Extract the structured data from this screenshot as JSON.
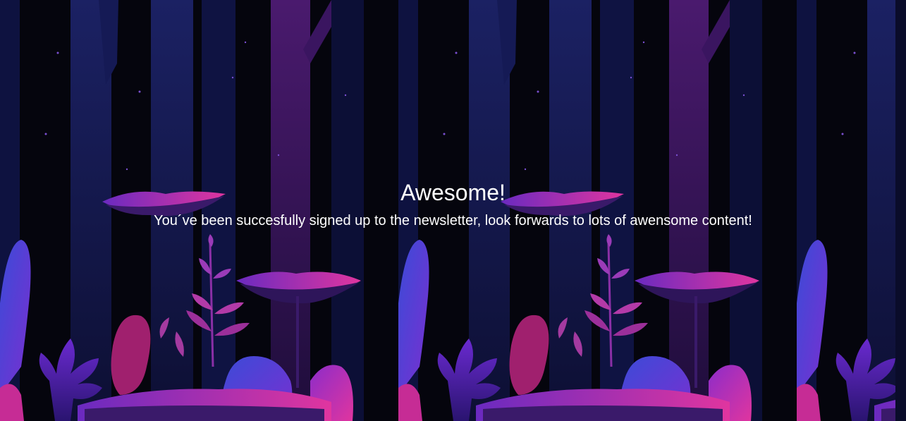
{
  "confirmation": {
    "title": "Awesome!",
    "message": "You´ve been succesfully signed up to the newsletter, look forwards to lots of awensome content!"
  },
  "background": {
    "description_icon": "forest-illustration",
    "colors": {
      "sky": "#05050d",
      "trunk_blue": "#1a1f5c",
      "trunk_purple": "#3d1560",
      "pink": "#e0359f",
      "violet": "#7a2fd0",
      "blue": "#3b4bd8"
    }
  }
}
